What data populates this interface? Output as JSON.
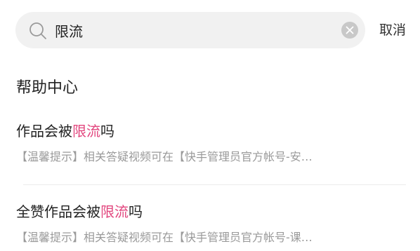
{
  "search": {
    "query": "限流",
    "placeholder": "",
    "cancel_label": "取消"
  },
  "section": {
    "title": "帮助中心"
  },
  "results": [
    {
      "title_before": "作品会被",
      "title_highlight": "限流",
      "title_after": "吗",
      "snippet": "【温馨提示】相关答疑视频可在【快手管理员官方帐号-安…"
    },
    {
      "title_before": "全赞作品会被",
      "title_highlight": "限流",
      "title_after": "吗",
      "snippet": "【温馨提示】相关答疑视频可在【快手管理员官方帐号-课…"
    }
  ],
  "colors": {
    "highlight": "#e2467e",
    "search_bg": "#f1f1f1",
    "snippet": "#9a9a9a"
  },
  "icons": {
    "search": "search-icon",
    "clear": "clear-icon"
  }
}
